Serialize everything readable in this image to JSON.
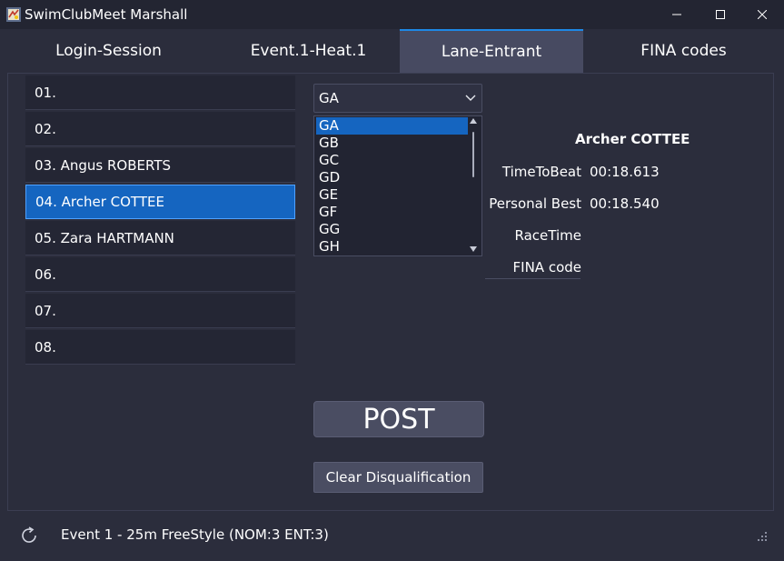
{
  "window": {
    "title": "SwimClubMeet Marshall",
    "minimize_glyph": "—",
    "maximize_glyph": "☐",
    "close_glyph": "✕"
  },
  "tabs": [
    {
      "label": "Login-Session",
      "active": false
    },
    {
      "label": "Event.1-Heat.1",
      "active": false
    },
    {
      "label": "Lane-Entrant",
      "active": true
    },
    {
      "label": "FINA codes",
      "active": false
    }
  ],
  "lanes": [
    {
      "label": "01.",
      "selected": false
    },
    {
      "label": "02.",
      "selected": false
    },
    {
      "label": "03. Angus ROBERTS",
      "selected": false
    },
    {
      "label": "04. Archer COTTEE",
      "selected": true
    },
    {
      "label": "05. Zara HARTMANN",
      "selected": false
    },
    {
      "label": "06.",
      "selected": false
    },
    {
      "label": "07.",
      "selected": false
    },
    {
      "label": "08.",
      "selected": false
    }
  ],
  "fina_combo": {
    "selected": "GA"
  },
  "fina_list": {
    "items": [
      "GA",
      "GB",
      "GC",
      "GD",
      "GE",
      "GF",
      "GG",
      "GH"
    ],
    "selected": "GA"
  },
  "entrant": {
    "name": "Archer COTTEE",
    "time_to_beat_label": "TimeToBeat",
    "time_to_beat_value": "00:18.613",
    "personal_best_label": "Personal Best",
    "personal_best_value": "00:18.540",
    "race_time_label": "RaceTime",
    "fina_code_label": "FINA code"
  },
  "buttons": {
    "post_label": "POST",
    "clear_dq_label": "Clear Disqualification"
  },
  "status": {
    "text": "Event 1 - 25m FreeStyle (NOM:3 ENT:3)"
  },
  "colors": {
    "accent": "#1e88e5",
    "selection": "#1565c0",
    "background": "#2b2d3c"
  },
  "icons": {
    "app": "app-icon",
    "refresh": "refresh-icon",
    "grip": "resize-grip-icon"
  }
}
